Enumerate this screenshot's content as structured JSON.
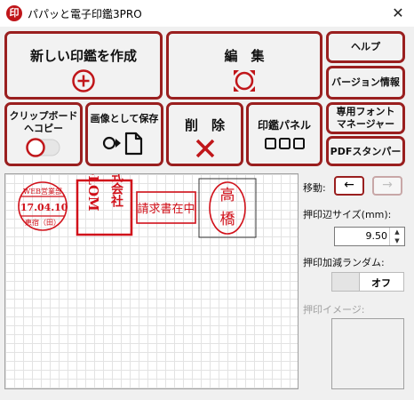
{
  "app": {
    "icon_glyph": "印",
    "title": "パパッと電子印鑑3PRO",
    "close_glyph": "✕"
  },
  "toolbar": {
    "new_stamp": {
      "label": "新しい印鑑を作成",
      "icon": "plus-circle-icon"
    },
    "edit": {
      "label": "編　集",
      "icon": "edit-circle-icon"
    },
    "help": {
      "label": "ヘルプ"
    },
    "version": {
      "label": "バージョン情報"
    },
    "clipboard_copy": {
      "label_line1": "クリップボード",
      "label_line2": "へコピー",
      "icon": "toggle-icon"
    },
    "save_image": {
      "label": "画像として保存",
      "icon": "save-file-icon"
    },
    "delete": {
      "label": "削　除",
      "icon": "x-icon"
    },
    "stamp_panel": {
      "label": "印鑑パネル",
      "icon": "three-squares-icon"
    },
    "font_manager": {
      "label_line1": "専用フォント",
      "label_line2": "マネージャー"
    },
    "pdf_stamper": {
      "label": "PDFスタンパー"
    }
  },
  "canvas": {
    "stamps": [
      {
        "type": "date-stamp",
        "top_text": "WEB営業部",
        "date": "'17.04.10",
        "bottom_text": "恵宿（田）"
      },
      {
        "type": "company-seal",
        "left_text": "TeLOM",
        "right_text": "株式会社"
      },
      {
        "type": "text-box",
        "text": "請求書在中"
      },
      {
        "type": "name-seal",
        "chars": [
          "高",
          "橋"
        ]
      }
    ]
  },
  "panel": {
    "move_label": "移動:",
    "move_left_glyph": "←",
    "move_right_glyph": "→",
    "size_label": "押印辺サイズ(mm):",
    "size_value": "9.50",
    "random_label": "押印加減ランダム:",
    "random_state": "オフ",
    "preview_label": "押印イメージ:"
  },
  "colors": {
    "accent": "#9a1f1f",
    "stamp_red": "#d1111a"
  }
}
